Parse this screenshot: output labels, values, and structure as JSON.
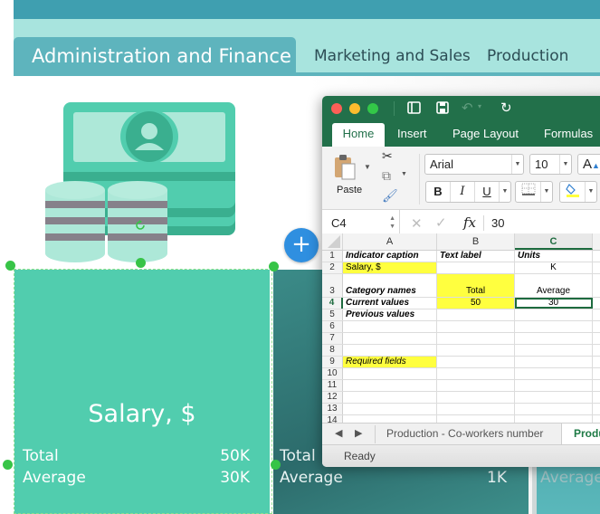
{
  "dashboard": {
    "tabs": [
      {
        "label": "Administration and Finance",
        "active": true
      },
      {
        "label": "Marketing and Sales",
        "active": false
      },
      {
        "label": "Production",
        "active": false
      }
    ],
    "add_button": "+",
    "cards": [
      {
        "title": "Salary, $",
        "total_label": "Total",
        "total_value": "50K",
        "average_label": "Average",
        "average_value": "30K"
      },
      {
        "title": "",
        "total_label": "Total",
        "total_value": "",
        "average_label": "Average",
        "average_value": "1K"
      },
      {
        "title": "",
        "average_label": "Average"
      }
    ],
    "colors": {
      "card_primary": "#51cdae",
      "card_secondary": "#2c6b6b",
      "tab_active": "#5eb4bd",
      "tab_strip": "#a8e4de",
      "banner": "#3f9fb0",
      "selection_handle": "#37c447"
    }
  },
  "excel": {
    "quick_access": {
      "sidebar_icon": "▯",
      "save_icon": "💾",
      "undo_icon": "↶",
      "redo_icon": "↻"
    },
    "ribbon_tabs": [
      "Home",
      "Insert",
      "Page Layout",
      "Formulas"
    ],
    "active_ribbon_tab": "Home",
    "clipboard": {
      "paste_label": "Paste"
    },
    "font": {
      "name": "Arial",
      "size": "10",
      "grow_label": "A"
    },
    "format_buttons": {
      "bold": "B",
      "italic": "I",
      "underline": "U"
    },
    "formula_bar": {
      "cell_ref": "C4",
      "fx_label": "fx",
      "value": "30"
    },
    "columns": [
      "A",
      "B",
      "C"
    ],
    "selected_column": "C",
    "rows": [
      {
        "n": "1",
        "a": "Indicator caption",
        "b": "Text label",
        "c": "Units"
      },
      {
        "n": "2",
        "a": "Salary, $",
        "b": "",
        "c": "K"
      },
      {
        "n": "3",
        "a": "Category names",
        "b": "Total",
        "c": "Average"
      },
      {
        "n": "4",
        "a": "Current values",
        "b": "50",
        "c": "30"
      },
      {
        "n": "5",
        "a": "Previous values",
        "b": "",
        "c": ""
      },
      {
        "n": "6",
        "a": "",
        "b": "",
        "c": ""
      },
      {
        "n": "7",
        "a": "",
        "b": "",
        "c": ""
      },
      {
        "n": "8",
        "a": "",
        "b": "",
        "c": ""
      },
      {
        "n": "9",
        "a": "Required fields",
        "b": "",
        "c": ""
      },
      {
        "n": "10",
        "a": "",
        "b": "",
        "c": ""
      },
      {
        "n": "11",
        "a": "",
        "b": "",
        "c": ""
      },
      {
        "n": "12",
        "a": "",
        "b": "",
        "c": ""
      },
      {
        "n": "13",
        "a": "",
        "b": "",
        "c": ""
      },
      {
        "n": "14",
        "a": "",
        "b": "",
        "c": ""
      }
    ],
    "active_cell": "C4",
    "highlight_color": "#ffff3f",
    "accent_color": "#22704a",
    "sheet_tabs": [
      {
        "label": "Production - Co-workers number",
        "active": false
      },
      {
        "label": "Produ",
        "active": true
      }
    ],
    "status": "Ready"
  }
}
